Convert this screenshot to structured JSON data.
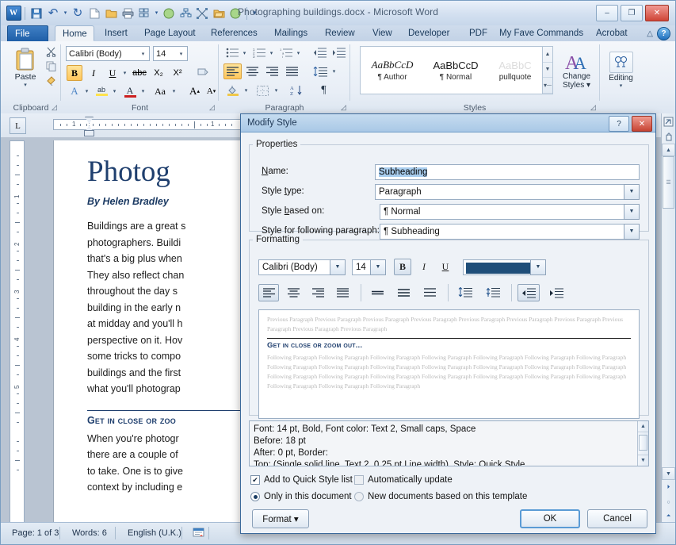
{
  "window": {
    "title": "Photographing buildings.docx  -  Microsoft Word",
    "minimize": "–",
    "restore": "❐",
    "close": "✕"
  },
  "quick_access": [
    {
      "name": "word-logo-icon",
      "glyph": "W"
    },
    {
      "name": "save-icon",
      "glyph": "💾"
    },
    {
      "name": "undo-icon",
      "glyph": "↶"
    },
    {
      "name": "undo-dropdown-icon",
      "glyph": "▾"
    },
    {
      "name": "redo-icon",
      "glyph": "↻"
    },
    {
      "name": "new-document-icon",
      "glyph": "□"
    },
    {
      "name": "open-folder-icon",
      "glyph": "📁"
    },
    {
      "name": "print-icon",
      "glyph": "⎙"
    },
    {
      "name": "organization-chart-icon",
      "glyph": "☷"
    },
    {
      "name": "organization-chart-dropdown-icon",
      "glyph": "▾"
    },
    {
      "name": "green-circle-icon",
      "glyph": "●"
    },
    {
      "name": "hierarchy-icon",
      "glyph": "⛓"
    },
    {
      "name": "transform-icon",
      "glyph": "⌗"
    },
    {
      "name": "open-file-icon",
      "glyph": "📂"
    },
    {
      "name": "green-circle-2-icon",
      "glyph": "●"
    },
    {
      "name": "customize-qat-icon",
      "glyph": "☰"
    }
  ],
  "tabs": [
    {
      "label": "File",
      "state": "file"
    },
    {
      "label": "Home",
      "state": "active"
    },
    {
      "label": "Insert",
      "state": ""
    },
    {
      "label": "Page Layout",
      "state": ""
    },
    {
      "label": "References",
      "state": ""
    },
    {
      "label": "Mailings",
      "state": ""
    },
    {
      "label": "Review",
      "state": ""
    },
    {
      "label": "View",
      "state": ""
    },
    {
      "label": "Developer",
      "state": ""
    },
    {
      "label": "PDF",
      "state": ""
    },
    {
      "label": "My Fave Commands",
      "state": ""
    },
    {
      "label": "Acrobat",
      "state": ""
    }
  ],
  "ribbon": {
    "groups": [
      {
        "name": "Clipboard"
      },
      {
        "name": "Font"
      },
      {
        "name": "Paragraph"
      },
      {
        "name": "Styles"
      }
    ],
    "clipboard": {
      "paste_label": "Paste",
      "paste_icon": "📋",
      "cut_icon": "✂",
      "copy_icon": "⧉",
      "format_painter_icon": "🖌"
    },
    "font": {
      "font_name": "Calibri (Body)",
      "font_size": "14",
      "bold": "B",
      "italic": "I",
      "underline": "U",
      "strikethrough": "abc",
      "subscript": "X₂",
      "superscript": "X²",
      "clear_formatting": "🗑",
      "text_effects": "A",
      "highlight": "ab",
      "font_color": "A",
      "change_case": "Aa",
      "grow_font": "A▴",
      "shrink_font": "A▾"
    },
    "paragraph": {
      "bullets": "≡",
      "numbering": "≡",
      "multilevel": "≡",
      "decrease_indent": "←≡",
      "increase_indent": "→≡",
      "align_left": "≡",
      "align_center": "≡",
      "align_right": "≡",
      "justify": "≡",
      "line_spacing": "↕≡",
      "shading": "▤",
      "borders": "⊞",
      "sort": "A↓",
      "show_marks": "¶"
    },
    "styles": {
      "items": [
        {
          "sample": "AaBbCcD",
          "name": "¶ Author",
          "style": "italic"
        },
        {
          "sample": "AaBbCcD",
          "name": "¶ Normal",
          "style": "normal"
        },
        {
          "sample": "AaBbC",
          "name": "pullquote",
          "style": "faint"
        }
      ],
      "change_styles_label": "Change",
      "change_styles_label2": "Styles ▾",
      "change_styles_icon": "A",
      "editing_label": "Editing",
      "editing_label2": "▾",
      "editing_icon": "🔍",
      "scroll_up": "▲",
      "scroll_down": "▼",
      "scroll_more": "☰"
    }
  },
  "document": {
    "title": "Photog",
    "byline": "By Helen Bradley",
    "body_lines": [
      "Buildings are a great s",
      "photographers. Buildi",
      "that's a big plus when",
      "They also reflect chan",
      "throughout the day s",
      "building in the early n",
      "at midday and you'll h",
      "perspective on it. Hov",
      "some tricks to compo",
      "buildings and the first",
      "what you'll photograp"
    ],
    "heading": "Get in close or zoo",
    "body_lines2": [
      "When you're photogr",
      "there are a couple of",
      "to take. One is to give",
      "context by including e"
    ],
    "tab_selector": "L",
    "ruler_numbers": [
      "1",
      "1"
    ],
    "vruler_numbers": [
      "1",
      "2",
      "3",
      "4",
      "5"
    ]
  },
  "status_bar": {
    "page": "Page: 1 of 3",
    "words": "Words: 6",
    "language": "English (U.K.)",
    "proofing_icon": "📖"
  },
  "dialog": {
    "title": "Modify Style",
    "help_button": "?",
    "close_button": "✕",
    "properties_legend": "Properties",
    "fields": [
      {
        "label": "Name:",
        "label_pre": "N",
        "label_post": "ame:",
        "value": "Subheading",
        "type": "text"
      },
      {
        "label": "Style type:",
        "value": "Paragraph",
        "type": "select"
      },
      {
        "label": "Style based on:",
        "value": "¶ Normal",
        "type": "select"
      },
      {
        "label": "Style for following paragraph:",
        "value": "¶ Subheading",
        "type": "select"
      }
    ],
    "formatting_legend": "Formatting",
    "formatting": {
      "font_name": "Calibri (Body)",
      "font_size": "14",
      "bold": "B",
      "italic": "I",
      "underline": "U",
      "font_color": "#1f4e79",
      "align_left": "≡",
      "align_center": "≡",
      "align_right": "≡",
      "justify": "≡",
      "spacing_single": "≡",
      "spacing_1_5": "≡",
      "spacing_double": "≡",
      "space_before": "↑≡",
      "space_after": "↓≡",
      "decrease_indent": "←≡",
      "increase_indent": "→≡"
    },
    "preview": {
      "previous_paragraph": "Previous Paragraph Previous Paragraph Previous Paragraph Previous Paragraph Previous Paragraph Previous Paragraph Previous Paragraph Previous Paragraph Previous Paragraph Previous Paragraph",
      "heading": "Get in close or zoom out...",
      "following_paragraph": "Following Paragraph Following Paragraph Following Paragraph Following Paragraph Following Paragraph Following Paragraph Following Paragraph Following Paragraph Following Paragraph Following Paragraph Following Paragraph Following Paragraph Following Paragraph Following Paragraph Following Paragraph Following Paragraph Following Paragraph Following Paragraph Following Paragraph Following Paragraph Following Paragraph Following Paragraph Following Paragraph Following Paragraph"
    },
    "description_lines": [
      "Font: 14 pt, Bold, Font color: Text 2, Small caps, Space",
      "   Before:  18 pt",
      "   After:  0 pt, Border:",
      "   Top: (Single solid line, Text 2,  0.25 pt Line width), Style: Quick Style"
    ],
    "options": {
      "add_quick_style": "Add to Quick Style list",
      "add_quick_style_checked": true,
      "auto_update": "Automatically update",
      "auto_update_checked": false,
      "only_this_document": "Only in this document",
      "only_this_document_selected": true,
      "new_documents": "New documents based on this template",
      "new_documents_selected": false
    },
    "buttons": {
      "format": "Format ▾",
      "ok": "OK",
      "cancel": "Cancel"
    },
    "scroll_up": "▲",
    "scroll_down": "▼"
  }
}
